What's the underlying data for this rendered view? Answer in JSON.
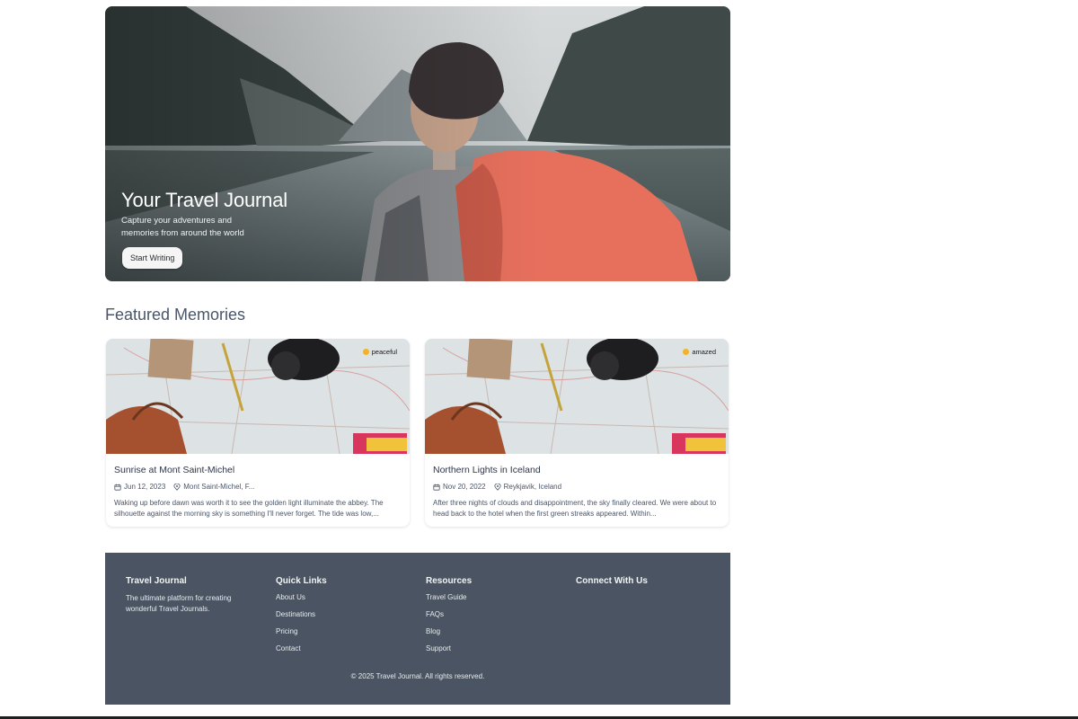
{
  "hero": {
    "title": "Your Travel Journal",
    "subtitle": "Capture your adventures and memories from around the world",
    "button_label": "Start Writing"
  },
  "featured": {
    "title": "Featured Memories",
    "cards": [
      {
        "title": "Sunrise at Mont Saint-Michel",
        "date": "Jun 12, 2023",
        "location": "Mont Saint-Michel, F...",
        "mood": "peaceful",
        "excerpt": "Waking up before dawn was worth it to see the golden light illuminate the abbey. The silhouette against the morning sky is something I'll never forget. The tide was low,..."
      },
      {
        "title": "Northern Lights in Iceland",
        "date": "Nov 20, 2022",
        "location": "Reykjavik, Iceland",
        "mood": "amazed",
        "excerpt": "After three nights of clouds and disappointment, the sky finally cleared. We were about to head back to the hotel when the first green streaks appeared. Within..."
      }
    ]
  },
  "footer": {
    "brand": {
      "title": "Travel Journal",
      "description": "The ultimate platform for creating wonderful Travel Journals."
    },
    "quick_links": {
      "title": "Quick Links",
      "items": [
        "About Us",
        "Destinations",
        "Pricing",
        "Contact"
      ]
    },
    "resources": {
      "title": "Resources",
      "items": [
        "Travel Guide",
        "FAQs",
        "Blog",
        "Support"
      ]
    },
    "connect": {
      "title": "Connect With Us"
    },
    "copyright": "© 2025 Travel Journal. All rights reserved."
  },
  "icons": {
    "calendar": "calendar-icon",
    "location": "location-pin-icon",
    "mood": "emoji-icon"
  },
  "colors": {
    "footer_bg": "#4a5462",
    "mood_dot": "#f0b429"
  }
}
